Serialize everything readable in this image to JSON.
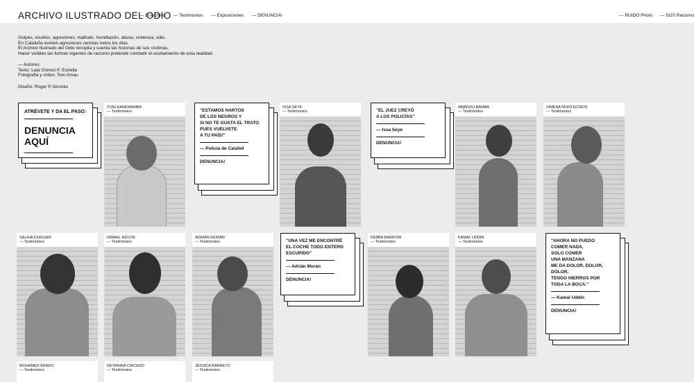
{
  "header": {
    "title": "ARCHIVO ILUSTRADO DEL ODIO",
    "nav": [
      "— El Archivo",
      "— Testimonios",
      "— Exposiciones",
      "— DENUNCIA!"
    ],
    "nav_right": [
      "— RUIDO Photo",
      "— SOS Racismo"
    ]
  },
  "intro": {
    "lines": [
      "Golpes, insultos, agresiones, maltrato, humillación, abuso, violencia, odio.",
      "En Cataluña existen agresiones racistas todos los días.",
      "El Archivo Ilustrado del Odio recopila y cuenta las historias de sus víctimas.",
      "Hacer visibles las formas vigentes de racismo pretende combatir el ocultamiento de esta realidad."
    ],
    "credits": [
      "— Autores:",
      "Texto: Laia Gómez-F. Estrella",
      "Fotografía y vídeo: Toni Arnau"
    ],
    "design": "Diseño: Roger P Gironès"
  },
  "cta": {
    "kicker": "ATRÉVETE Y DA EL PASO:",
    "big_line1": "DENUNCIA",
    "big_line2": "AQUÍ"
  },
  "category": "— Testimonios",
  "cards": [
    {
      "name": "TONI KANKWAMBA"
    },
    {
      "name": "ISSA SEYE"
    },
    {
      "name": "AMADOU BAMBA"
    },
    {
      "name": "XIMENA MONTECINOS"
    },
    {
      "name": "SALIHA CHIGUER"
    },
    {
      "name": "ISMAEL NDOYE"
    },
    {
      "name": "ADRIÁN MORÁN"
    },
    {
      "name": "KEBBA BARROW"
    },
    {
      "name": "KAMAL UDDIN"
    },
    {
      "name": "MOHAMED BANDO"
    },
    {
      "name": "DEYANIRA CAICEDO"
    },
    {
      "name": "JÉSSICA BARRETO"
    }
  ],
  "quotes": [
    {
      "text_lines": [
        "\"ESTAMOS HARTOS",
        "DE LOS NEGROS Y",
        "SI NO TE GUSTA EL TRATO",
        "PUES VUÉLVETE",
        "A TU PAÍS!\""
      ],
      "author": "— Policía de Calafell",
      "cta": "DENUNCIA!"
    },
    {
      "text_lines": [
        "\"EL JUEZ CREYÓ",
        "A LOS POLICÍAS\""
      ],
      "author": "— Issa Seye",
      "cta": "DENUNCIA!"
    },
    {
      "text_lines": [
        "\"UNA VEZ ME ENCONTRÉ",
        "EL COCHE TODO ENTERO",
        "ESCUPIDO\""
      ],
      "author": "— Adrián Morán",
      "cta": "DENUNCIA!"
    },
    {
      "text_lines": [
        "\"AHORA NO PUEDO",
        "COMER NADA,",
        "SOLO COMER",
        "UNA MANZANA",
        "ME DA DOLOR, DOLOR,",
        "DOLOR.",
        "TENGO HIERROS POR",
        "TODA LA BOCA.\""
      ],
      "author": "— Kamal Uddin",
      "cta": "DENUNCIA!"
    }
  ]
}
